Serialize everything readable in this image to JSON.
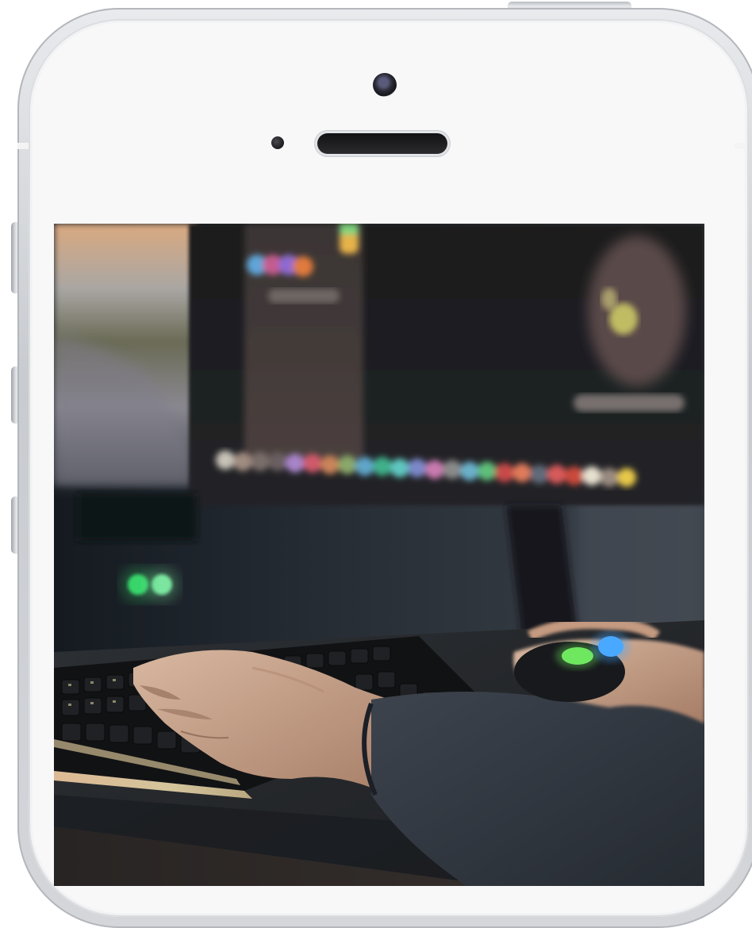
{
  "device": {
    "model": "smartphone-mockup",
    "frame_color": "#d3d5d8",
    "accent_color": "#3a4aa0"
  },
  "screen": {
    "content": "photo",
    "photo_subject": "hands-on-backlit-keyboard-and-gaming-mouse"
  },
  "icons": {
    "camera": "front-camera-icon",
    "speaker": "earpiece-speaker-icon",
    "sensor": "proximity-sensor-icon"
  }
}
